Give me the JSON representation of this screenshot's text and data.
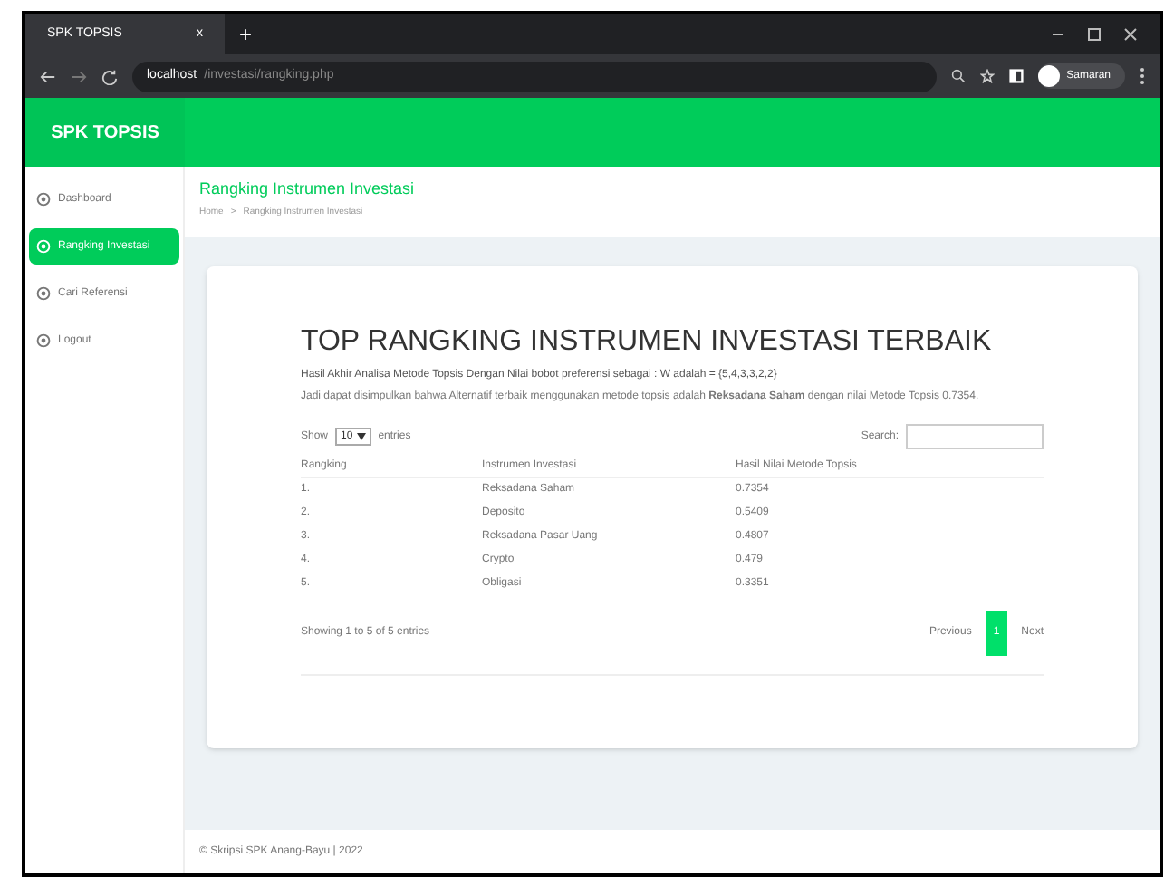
{
  "browser": {
    "tab_title": "SPK TOPSIS",
    "new_tab": "+",
    "close_tab": "x",
    "url_host": "localhost",
    "url_path": "/investasi/rangking.php",
    "profile": "Samaran"
  },
  "brand": "SPK TOPSIS",
  "sidebar": {
    "items": [
      {
        "label": "Dashboard",
        "selected": false
      },
      {
        "label": "Rangking Investasi",
        "selected": true
      },
      {
        "label": "Cari Referensi",
        "selected": false
      },
      {
        "label": "Logout",
        "selected": false
      }
    ]
  },
  "page": {
    "title": "Rangking Instrumen Investasi",
    "breadcrumb": [
      "Home",
      ">",
      "Rangking Instrumen Investasi"
    ]
  },
  "card": {
    "heading": "TOP RANGKING INSTRUMEN INVESTASI TERBAIK",
    "line_1": "Hasil Akhir Analisa Metode Topsis Dengan Nilai bobot preferensi sebagai : W adalah = {5,4,3,3,2,2}",
    "line_2": "Jadi dapat disimpulkan bahwa Alternatif terbaik menggunakan metode topsis adalah **Reksadana Saham** dengan nilai Metode Topsis 0.7354.",
    "show_label": "Show",
    "show_value": "10",
    "entries_label": "entries",
    "search_label": "Search:",
    "table": {
      "columns": [
        "Rangking",
        "Instrumen Investasi",
        "Hasil Nilai Metode Topsis"
      ],
      "rows": [
        [
          "1.",
          "Reksadana Saham",
          "0.7354"
        ],
        [
          "2.",
          "Deposito",
          "0.5409"
        ],
        [
          "3.",
          "Reksadana Pasar Uang",
          "0.4807"
        ],
        [
          "4.",
          "Crypto",
          "0.479"
        ],
        [
          "5.",
          "Obligasi",
          "0.3351"
        ]
      ]
    },
    "info": "Showing 1 to 5 of 5 entries",
    "pagination": [
      {
        "label": "Previous",
        "selected": false
      },
      {
        "label": "1",
        "selected": true
      },
      {
        "label": "Next",
        "selected": false
      }
    ]
  },
  "footer": "© Skripsi SPK Anang-Bayu | 2022"
}
